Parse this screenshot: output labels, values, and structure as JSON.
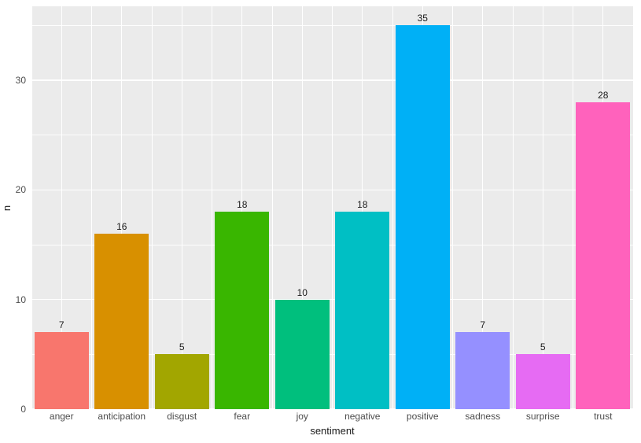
{
  "chart_data": {
    "type": "bar",
    "categories": [
      "anger",
      "anticipation",
      "disgust",
      "fear",
      "joy",
      "negative",
      "positive",
      "sadness",
      "surprise",
      "trust"
    ],
    "values": [
      7,
      16,
      5,
      18,
      10,
      18,
      35,
      7,
      5,
      28
    ],
    "colors": [
      "#f8766d",
      "#d89000",
      "#a2a600",
      "#39b600",
      "#00bf7d",
      "#00bfc4",
      "#00b0f6",
      "#9590ff",
      "#e66bf3",
      "#ff62bc"
    ],
    "xlabel": "sentiment",
    "ylabel": "n",
    "ylim": [
      0,
      36.75
    ],
    "ybreaks": [
      0,
      10,
      20,
      30
    ],
    "yminor": [
      5,
      15,
      25,
      35
    ],
    "grid": true
  }
}
